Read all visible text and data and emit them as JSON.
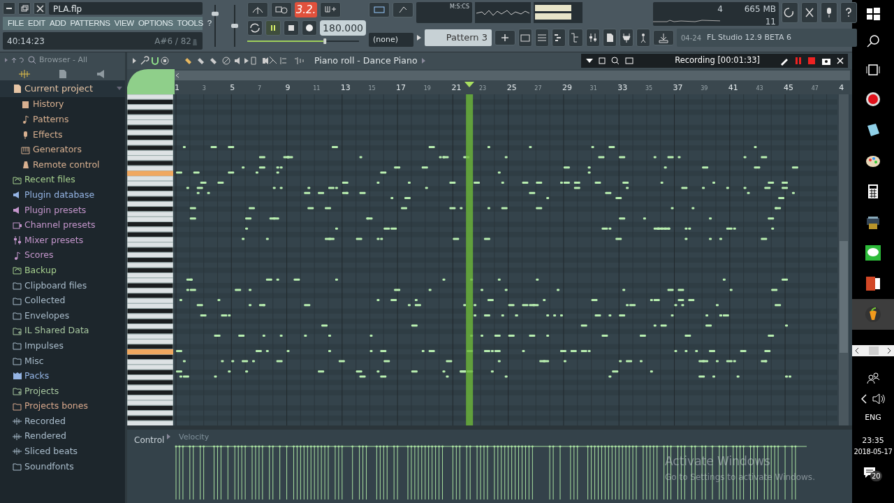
{
  "window": {
    "title": "PLA.flp"
  },
  "menu": [
    "FILE",
    "EDIT",
    "ADD",
    "PATTERNS",
    "VIEW",
    "OPTIONS",
    "TOOLS",
    "?"
  ],
  "hint_bar": {
    "time": "40:14:23",
    "note": "A#6 / 82"
  },
  "mixer": {
    "master_volume": {
      "level": 0.82
    },
    "master_pitch": {
      "level": 0.5
    }
  },
  "transport": {
    "main_pitch": {
      "level": 0.7
    },
    "pattern_mode_display": "3.2.",
    "playing": true,
    "tempo": "180.000",
    "snap": "(none)",
    "time_format": "M:S:CS"
  },
  "pattern": {
    "name": "Pattern 3"
  },
  "monitor": {
    "cpu": "4",
    "memory": "665 MB",
    "polyphony": "11"
  },
  "hint_panel": {
    "date": "04-24",
    "text": "FL Studio 12.9 BETA 6"
  },
  "browser": {
    "title": "Browser - All",
    "items": [
      {
        "label": "Current project",
        "kind": "project",
        "color": "#e6c4a4",
        "expanded": true,
        "children": [
          {
            "label": "History",
            "kind": "history",
            "color": "#d8b090"
          },
          {
            "label": "Patterns",
            "kind": "note",
            "color": "#d8b090"
          },
          {
            "label": "Effects",
            "kind": "effects",
            "color": "#d8b090"
          },
          {
            "label": "Generators",
            "kind": "generators",
            "color": "#d8b090"
          },
          {
            "label": "Remote control",
            "kind": "remote",
            "color": "#d8b090"
          }
        ]
      },
      {
        "label": "Recent files",
        "kind": "recent",
        "color": "#a6d08e"
      },
      {
        "label": "Plugin database",
        "kind": "plugin",
        "color": "#94b4e4"
      },
      {
        "label": "Plugin presets",
        "kind": "plugin",
        "color": "#c496cc"
      },
      {
        "label": "Channel presets",
        "kind": "channel",
        "color": "#c496cc"
      },
      {
        "label": "Mixer presets",
        "kind": "mixer",
        "color": "#c496cc"
      },
      {
        "label": "Scores",
        "kind": "note",
        "color": "#c496cc"
      },
      {
        "label": "Backup",
        "kind": "recent",
        "color": "#a6d08e"
      },
      {
        "label": "Clipboard files",
        "kind": "folder",
        "color": "#a9bccb"
      },
      {
        "label": "Collected",
        "kind": "folder",
        "color": "#a9bccb"
      },
      {
        "label": "Envelopes",
        "kind": "folder",
        "color": "#a9bccb"
      },
      {
        "label": "IL Shared Data",
        "kind": "linkfolder",
        "color": "#a8c8a0"
      },
      {
        "label": "Impulses",
        "kind": "folder",
        "color": "#a9bccb"
      },
      {
        "label": "Misc",
        "kind": "folder",
        "color": "#a9bccb"
      },
      {
        "label": "Packs",
        "kind": "pack",
        "color": "#94b4e4"
      },
      {
        "label": "Projects",
        "kind": "linkfolder",
        "color": "#a8c8a0"
      },
      {
        "label": "Projects bones",
        "kind": "folder",
        "color": "#d8a88c"
      },
      {
        "label": "Recorded",
        "kind": "wave",
        "color": "#a9bccb"
      },
      {
        "label": "Rendered",
        "kind": "wave",
        "color": "#a9bccb"
      },
      {
        "label": "Sliced beats",
        "kind": "wave",
        "color": "#a9bccb"
      },
      {
        "label": "Soundfonts",
        "kind": "folder",
        "color": "#a9bccb"
      }
    ]
  },
  "piano_roll": {
    "title": "Piano roll - Dance Piano",
    "recording": "Recording [00:01:33]",
    "ruler": [
      "1",
      "3",
      "5",
      "7",
      "9",
      "11",
      "13",
      "15",
      "17",
      "19",
      "21",
      "23",
      "25",
      "27",
      "29",
      "31",
      "33",
      "35",
      "37",
      "39",
      "41",
      "43",
      "45",
      "47",
      "4"
    ],
    "control_label": "Control",
    "control_target": "Velocity"
  },
  "activation": {
    "title": "Activate Windows",
    "text": "Go to Settings to activate Windows."
  },
  "taskbar": {
    "language": "ENG",
    "time": "23:35",
    "date": "2018-05-17",
    "notifications": "20",
    "apps": [
      {
        "kind": "record",
        "selected": false
      },
      {
        "kind": "notepad",
        "selected": false
      },
      {
        "kind": "paint",
        "selected": false
      },
      {
        "kind": "calculator",
        "selected": false
      },
      {
        "kind": "printer",
        "selected": false
      },
      {
        "kind": "chat",
        "selected": false
      },
      {
        "kind": "slides",
        "selected": false
      },
      {
        "kind": "fruit",
        "selected": true
      }
    ]
  }
}
